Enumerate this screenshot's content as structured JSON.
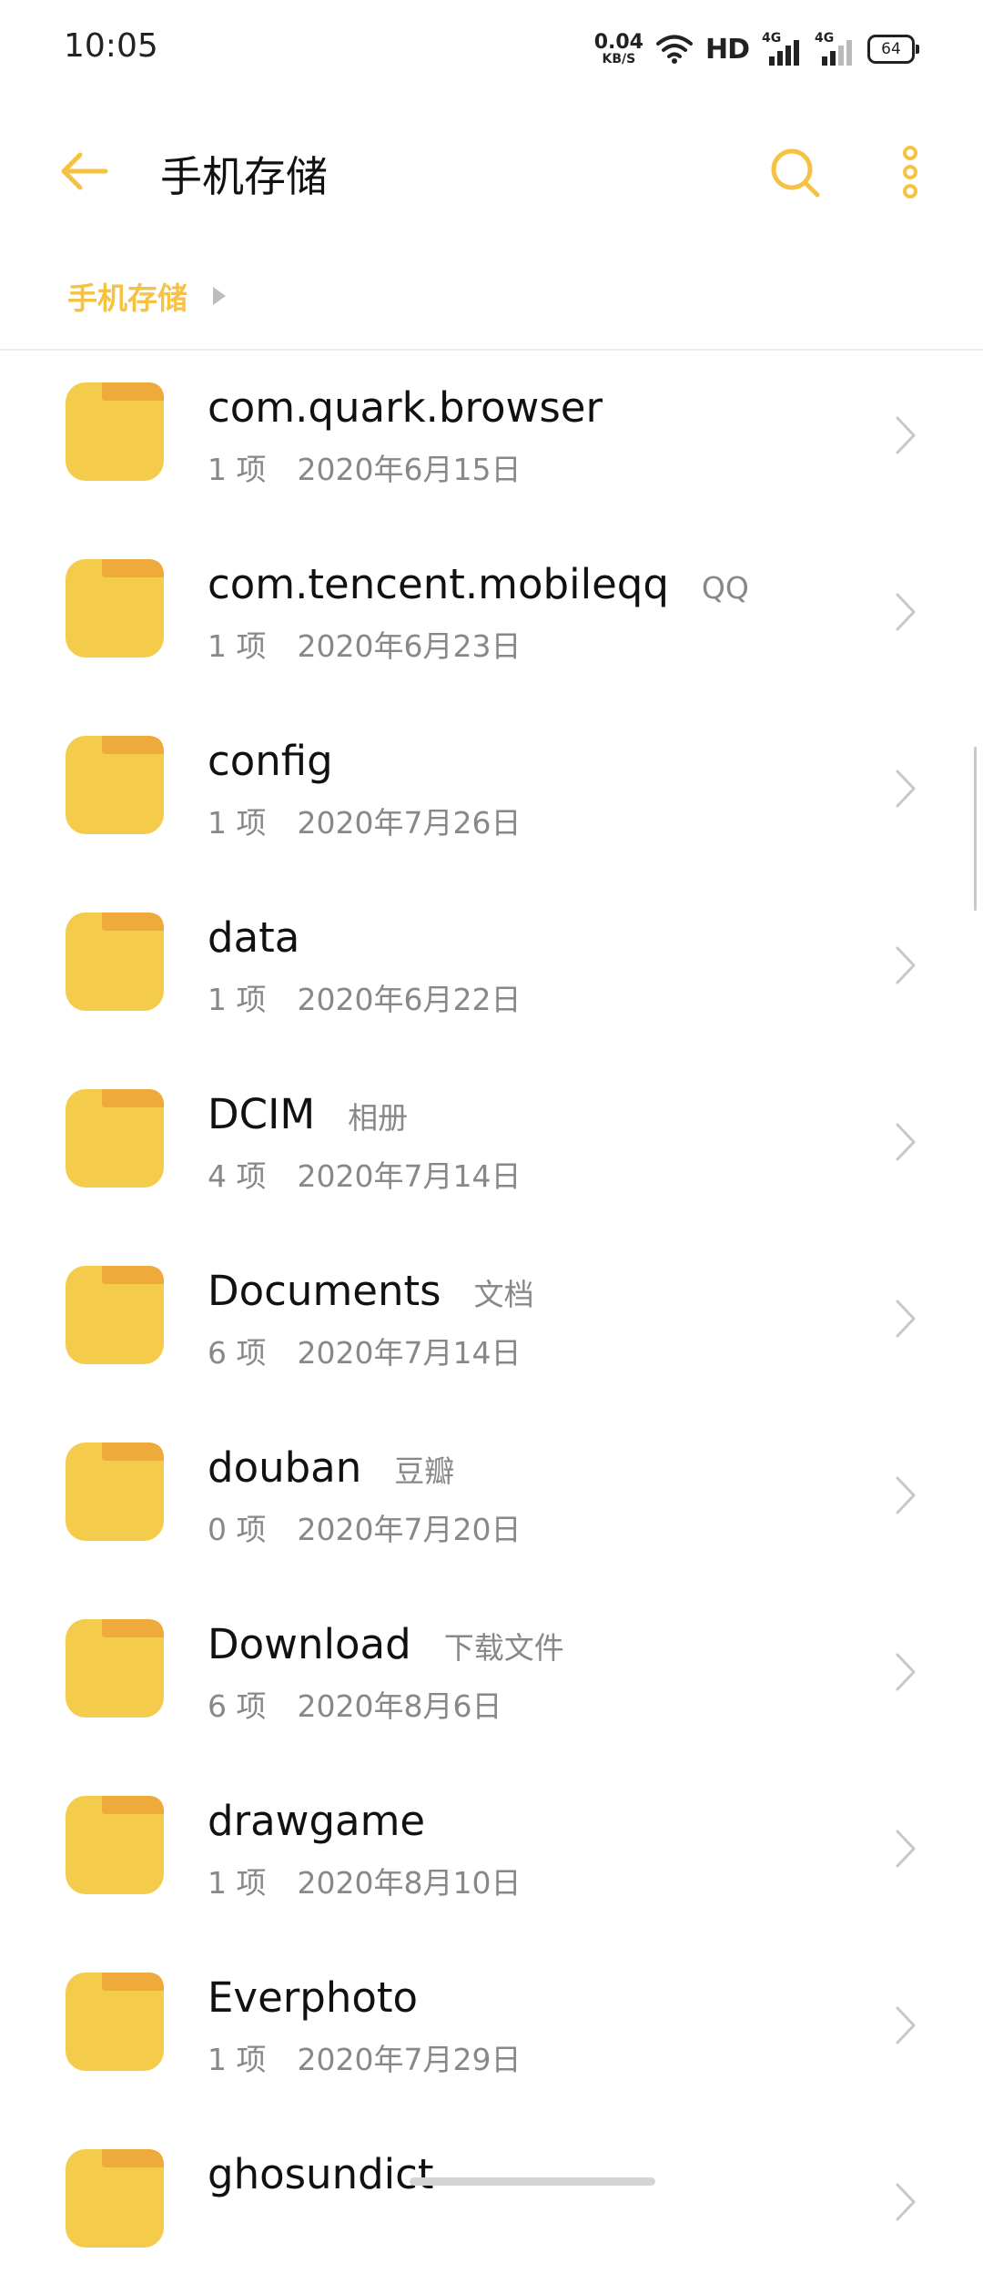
{
  "status_bar": {
    "time": "10:05",
    "net_speed": "0.04",
    "net_speed_unit": "KB/S",
    "hd": "HD",
    "sim1": "4G",
    "sim2": "4G",
    "battery": "64"
  },
  "header": {
    "title": "手机存储",
    "back_icon": "arrow-left-icon",
    "search_icon": "search-icon",
    "more_icon": "more-vertical-icon"
  },
  "breadcrumb": {
    "current": "手机存储"
  },
  "accent_color": "#F5C242",
  "folders": [
    {
      "name": "com.quark.browser",
      "alias": "",
      "count": "1 项",
      "date": "2020年6月15日"
    },
    {
      "name": "com.tencent.mobileqq",
      "alias": "QQ",
      "count": "1 项",
      "date": "2020年6月23日"
    },
    {
      "name": "config",
      "alias": "",
      "count": "1 项",
      "date": "2020年7月26日"
    },
    {
      "name": "data",
      "alias": "",
      "count": "1 项",
      "date": "2020年6月22日"
    },
    {
      "name": "DCIM",
      "alias": "相册",
      "count": "4 项",
      "date": "2020年7月14日"
    },
    {
      "name": "Documents",
      "alias": "文档",
      "count": "6 项",
      "date": "2020年7月14日"
    },
    {
      "name": "douban",
      "alias": "豆瓣",
      "count": "0 项",
      "date": "2020年7月20日"
    },
    {
      "name": "Download",
      "alias": "下载文件",
      "count": "6 项",
      "date": "2020年8月6日"
    },
    {
      "name": "drawgame",
      "alias": "",
      "count": "1 项",
      "date": "2020年8月10日"
    },
    {
      "name": "Everphoto",
      "alias": "",
      "count": "1 项",
      "date": "2020年7月29日"
    },
    {
      "name": "ghosundict",
      "alias": "",
      "count": "",
      "date": ""
    }
  ]
}
